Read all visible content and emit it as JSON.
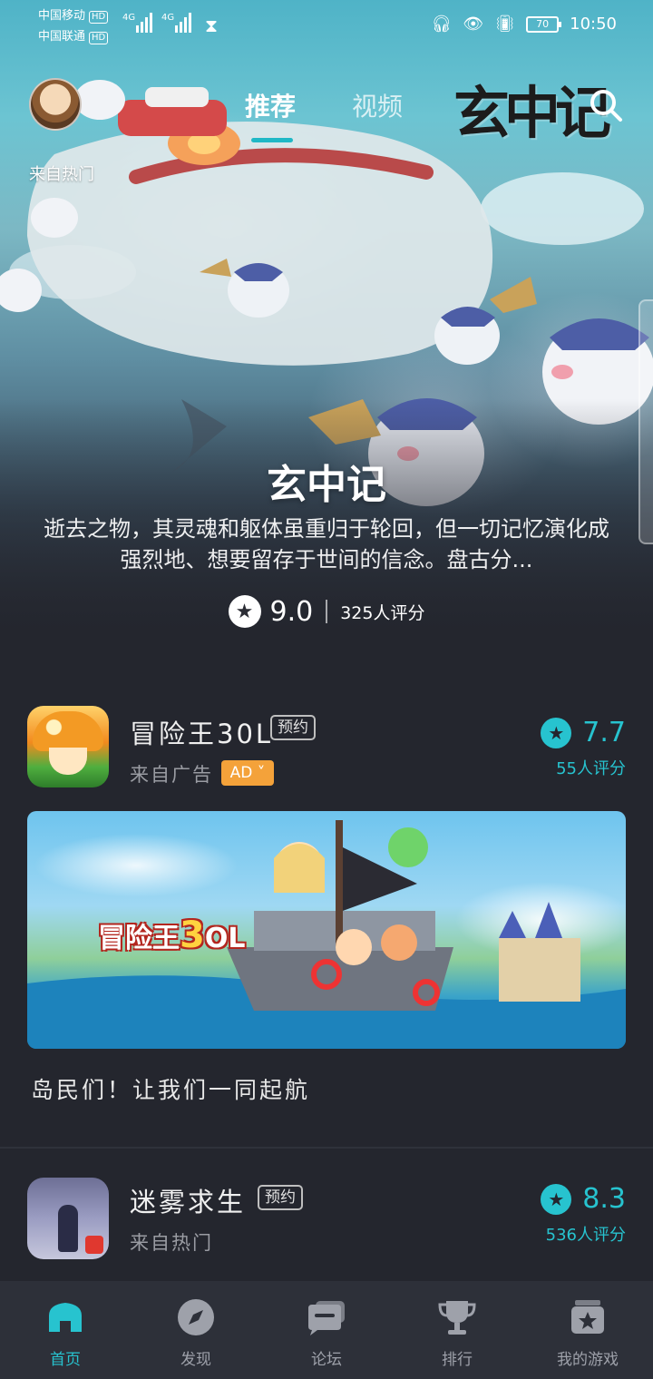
{
  "status_bar": {
    "carrier_1": "中国移动",
    "carrier_2": "中国联通",
    "hd_label": "HD",
    "network_1": "4G",
    "network_2": "4G",
    "battery": "70",
    "time": "10:50"
  },
  "top_nav": {
    "avatar_tag": "来自热门",
    "tabs": [
      {
        "label": "推荐",
        "active": true
      },
      {
        "label": "视频",
        "active": false
      }
    ],
    "game_logo_text": "玄中记"
  },
  "hero": {
    "title": "玄中记",
    "description": "逝去之物，其灵魂和躯体虽重归于轮回，但一切记忆演化成强烈地、想要留存于世间的信念。盘古分...",
    "score": "9.0",
    "rating_count": "325人评分"
  },
  "feed": [
    {
      "name": "冒险王30L",
      "tag": "预约",
      "source": "来自广告",
      "ad_badge": "AD",
      "score": "7.7",
      "rating_count": "55人评分",
      "banner_logo_prefix": "冒险王",
      "banner_logo_num": "3",
      "banner_logo_suffix": "OL",
      "caption": "岛民们！让我们一同起航"
    },
    {
      "name": "迷雾求生",
      "tag": "预约",
      "source": "来自热门",
      "score": "8.3",
      "rating_count": "536人评分"
    }
  ],
  "bottom_nav": [
    {
      "label": "首页",
      "icon": "home-icon",
      "active": true
    },
    {
      "label": "发现",
      "icon": "compass-icon",
      "active": false
    },
    {
      "label": "论坛",
      "icon": "forum-icon",
      "active": false
    },
    {
      "label": "排行",
      "icon": "trophy-icon",
      "active": false
    },
    {
      "label": "我的游戏",
      "icon": "my-games-icon",
      "active": false
    }
  ],
  "colors": {
    "accent": "#27c3cf",
    "background": "#24262e",
    "ad_badge": "#f4a23a"
  }
}
